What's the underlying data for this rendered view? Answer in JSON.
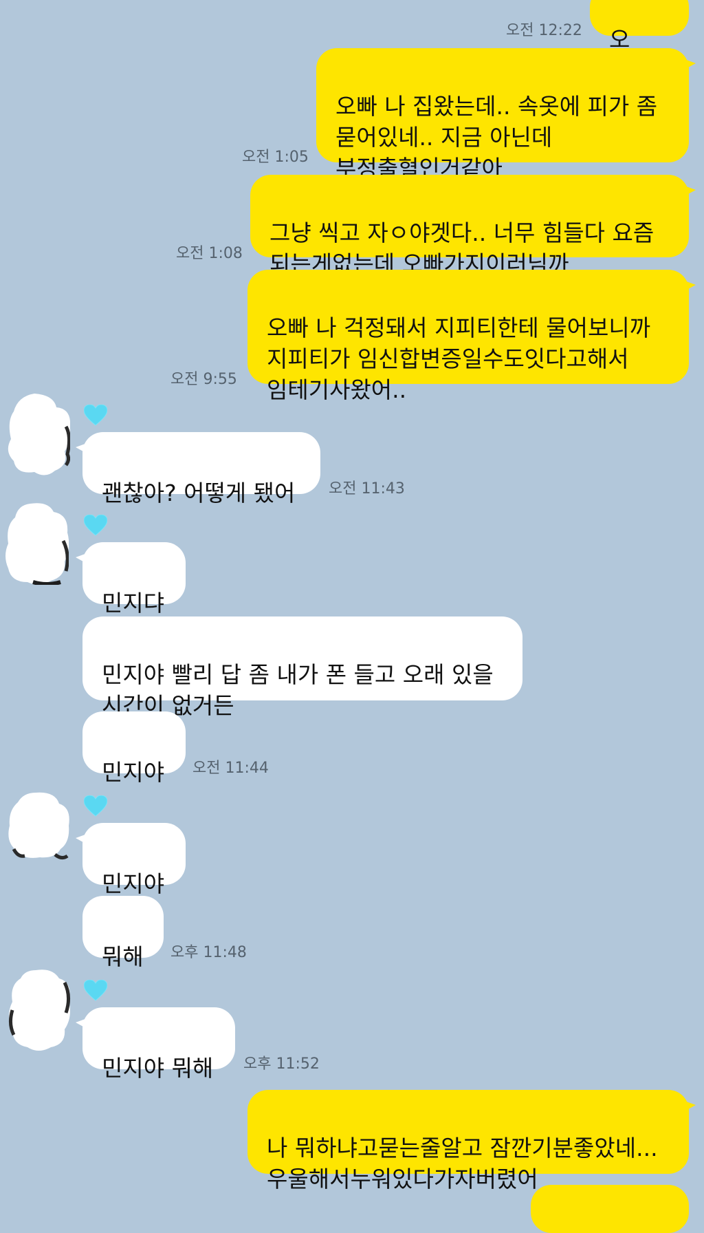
{
  "messages": [
    {
      "id": "m0",
      "text": "오빠..."
    },
    {
      "id": "m1",
      "text": "오빠 나 집왔는데.. 속옷에 피가 좀\n묻어있네.. 지금 아닌데\n부정출혈인거같아"
    },
    {
      "id": "m2",
      "text": "그냥 씩고 자ㅇ야겟다.. 너무 힘들다 요즘\n되는게없는데 오빠가지이러님까"
    },
    {
      "id": "m3",
      "text": "오빠 나 걱정돼서 지피티한테 물어보니까\n지피티가 임신합변증일수도잇다고해서\n임테기사왔어.."
    },
    {
      "id": "m4",
      "text": "괜찮아? 어떻게 됐어"
    },
    {
      "id": "m5",
      "text": "민지댜"
    },
    {
      "id": "m6",
      "text": "민지야 빨리 답 좀 내가 폰 들고 오래 있을\n시간이 없거든"
    },
    {
      "id": "m7",
      "text": "민지야"
    },
    {
      "id": "m8",
      "text": "민지야"
    },
    {
      "id": "m9",
      "text": "뭐해"
    },
    {
      "id": "m10",
      "text": "민지야 뭐해"
    },
    {
      "id": "m11",
      "text": "나 뭐하냐고묻는줄알고 잠깐기분좋았네...\n우울해서누워있다가자버렸어"
    }
  ],
  "times": {
    "t0": "오전 12:22",
    "t1": "오전 1:05",
    "t2": "오전 1:08",
    "t3": "오전 9:55",
    "t4": "오전 11:43",
    "t5": "오전 11:44",
    "t6": "오후 11:48",
    "t7": "오후 11:52"
  },
  "colors": {
    "background": "#b2c7da",
    "my_bubble": "#fee500",
    "their_bubble": "#ffffff",
    "heart": "#5ad8f2"
  },
  "icons": {
    "heart": "cyan-heart-icon",
    "avatar": "blurred-profile-avatar"
  }
}
